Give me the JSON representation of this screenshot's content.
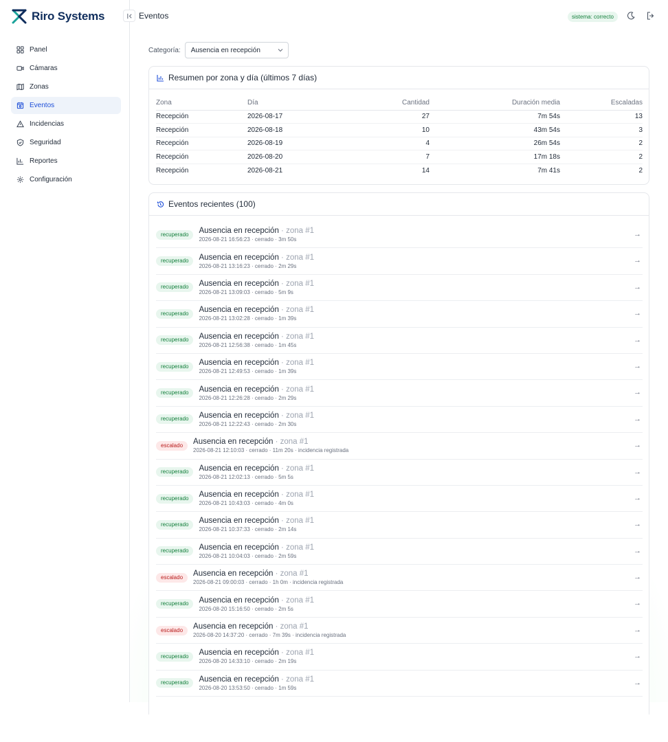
{
  "brand": {
    "name": "Riro Systems"
  },
  "sidebar": {
    "items": [
      {
        "label": "Panel",
        "icon": "dashboard-icon",
        "active": false
      },
      {
        "label": "Cámaras",
        "icon": "camera-icon",
        "active": false
      },
      {
        "label": "Zonas",
        "icon": "map-icon",
        "active": false
      },
      {
        "label": "Eventos",
        "icon": "events-icon",
        "active": true
      },
      {
        "label": "Incidencias",
        "icon": "warning-icon",
        "active": false
      },
      {
        "label": "Seguridad",
        "icon": "shield-icon",
        "active": false
      },
      {
        "label": "Reportes",
        "icon": "chart-icon",
        "active": false
      },
      {
        "label": "Configuración",
        "icon": "gear-icon",
        "active": false
      }
    ]
  },
  "header": {
    "title": "Eventos",
    "status": "sistema: correcto",
    "theme_icon": "moon-icon",
    "logout_icon": "logout-icon"
  },
  "filter": {
    "label": "Categoría:",
    "value": "Ausencia en recepción"
  },
  "summary": {
    "title": "Resumen por zona y día (últimos 7 días)",
    "columns": [
      "Zona",
      "Día",
      "Cantidad",
      "Duración media",
      "Escaladas"
    ],
    "rows": [
      [
        "Recepción",
        "2026-08-17",
        "27",
        "7m 54s",
        "13"
      ],
      [
        "Recepción",
        "2026-08-18",
        "10",
        "43m 54s",
        "3"
      ],
      [
        "Recepción",
        "2026-08-19",
        "4",
        "26m 54s",
        "2"
      ],
      [
        "Recepción",
        "2026-08-20",
        "7",
        "17m 18s",
        "2"
      ],
      [
        "Recepción",
        "2026-08-21",
        "14",
        "7m 41s",
        "2"
      ]
    ]
  },
  "recent": {
    "title": "Eventos recientes (100)",
    "events": [
      {
        "status": "recuperado",
        "kind": "ok",
        "title": "Ausencia en recepción",
        "zone": "· zona #1",
        "meta": "2026-08-21 16:56:23 · cerrado · 3m 50s"
      },
      {
        "status": "recuperado",
        "kind": "ok",
        "title": "Ausencia en recepción",
        "zone": "· zona #1",
        "meta": "2026-08-21 13:16:23 · cerrado · 2m 29s"
      },
      {
        "status": "recuperado",
        "kind": "ok",
        "title": "Ausencia en recepción",
        "zone": "· zona #1",
        "meta": "2026-08-21 13:09:03 · cerrado · 5m 9s"
      },
      {
        "status": "recuperado",
        "kind": "ok",
        "title": "Ausencia en recepción",
        "zone": "· zona #1",
        "meta": "2026-08-21 13:02:28 · cerrado · 1m 39s"
      },
      {
        "status": "recuperado",
        "kind": "ok",
        "title": "Ausencia en recepción",
        "zone": "· zona #1",
        "meta": "2026-08-21 12:56:38 · cerrado · 1m 45s"
      },
      {
        "status": "recuperado",
        "kind": "ok",
        "title": "Ausencia en recepción",
        "zone": "· zona #1",
        "meta": "2026-08-21 12:49:53 · cerrado · 1m 39s"
      },
      {
        "status": "recuperado",
        "kind": "ok",
        "title": "Ausencia en recepción",
        "zone": "· zona #1",
        "meta": "2026-08-21 12:26:28 · cerrado · 2m 29s"
      },
      {
        "status": "recuperado",
        "kind": "ok",
        "title": "Ausencia en recepción",
        "zone": "· zona #1",
        "meta": "2026-08-21 12:22:43 · cerrado · 2m 30s"
      },
      {
        "status": "escalado",
        "kind": "esc",
        "title": "Ausencia en recepción",
        "zone": "· zona #1",
        "meta": "2026-08-21 12:10:03 · cerrado · 11m 20s · incidencia registrada"
      },
      {
        "status": "recuperado",
        "kind": "ok",
        "title": "Ausencia en recepción",
        "zone": "· zona #1",
        "meta": "2026-08-21 12:02:13 · cerrado · 5m 5s"
      },
      {
        "status": "recuperado",
        "kind": "ok",
        "title": "Ausencia en recepción",
        "zone": "· zona #1",
        "meta": "2026-08-21 10:43:03 · cerrado · 4m 0s"
      },
      {
        "status": "recuperado",
        "kind": "ok",
        "title": "Ausencia en recepción",
        "zone": "· zona #1",
        "meta": "2026-08-21 10:37:33 · cerrado · 2m 14s"
      },
      {
        "status": "recuperado",
        "kind": "ok",
        "title": "Ausencia en recepción",
        "zone": "· zona #1",
        "meta": "2026-08-21 10:04:03 · cerrado · 2m 59s"
      },
      {
        "status": "escalado",
        "kind": "esc",
        "title": "Ausencia en recepción",
        "zone": "· zona #1",
        "meta": "2026-08-21 09:00:03 · cerrado · 1h 0m · incidencia registrada"
      },
      {
        "status": "recuperado",
        "kind": "ok",
        "title": "Ausencia en recepción",
        "zone": "· zona #1",
        "meta": "2026-08-20 15:16:50 · cerrado · 2m 5s"
      },
      {
        "status": "escalado",
        "kind": "esc",
        "title": "Ausencia en recepción",
        "zone": "· zona #1",
        "meta": "2026-08-20 14:37:20 · cerrado · 7m 39s · incidencia registrada"
      },
      {
        "status": "recuperado",
        "kind": "ok",
        "title": "Ausencia en recepción",
        "zone": "· zona #1",
        "meta": "2026-08-20 14:33:10 · cerrado · 2m 19s"
      },
      {
        "status": "recuperado",
        "kind": "ok",
        "title": "Ausencia en recepción",
        "zone": "· zona #1",
        "meta": "2026-08-20 13:53:50 · cerrado · 1m 59s"
      }
    ],
    "arrow": "→"
  },
  "colors": {
    "accent": "#1d4ed8",
    "success": "#15803d",
    "danger": "#b91c1c",
    "brand_teal": "#1aa39a",
    "brand_navy": "#0f2d5c"
  }
}
